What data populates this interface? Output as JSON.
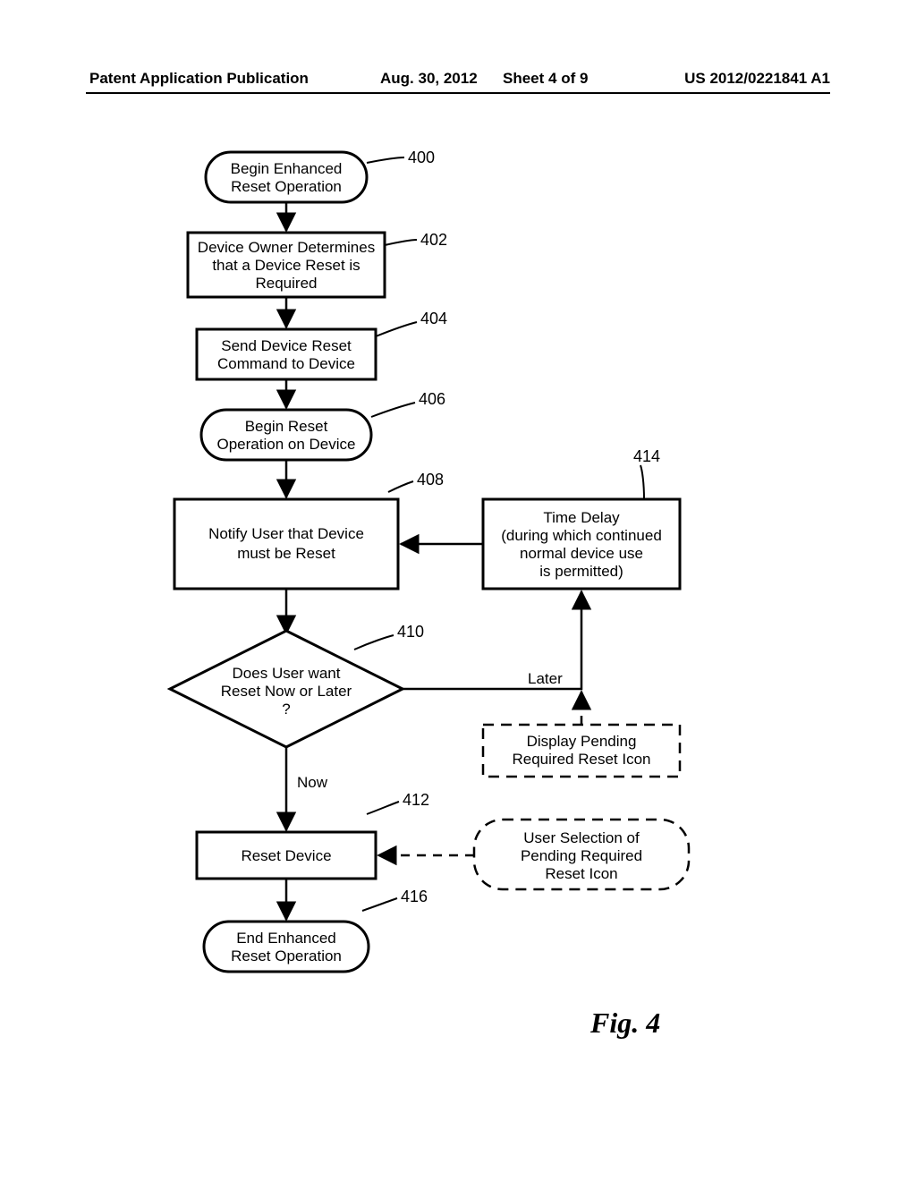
{
  "header": {
    "left": "Patent Application Publication",
    "date": "Aug. 30, 2012",
    "sheet": "Sheet 4 of 9",
    "pubno": "US 2012/0221841 A1"
  },
  "nodes": {
    "n400": {
      "ref": "400",
      "line1": "Begin Enhanced",
      "line2": "Reset Operation"
    },
    "n402": {
      "ref": "402",
      "line1": "Device Owner Determines",
      "line2": "that a Device Reset is",
      "line3": "Required"
    },
    "n404": {
      "ref": "404",
      "line1": "Send Device Reset",
      "line2": "Command to Device"
    },
    "n406": {
      "ref": "406",
      "line1": "Begin Reset",
      "line2": "Operation on Device"
    },
    "n408": {
      "ref": "408",
      "line1": "Notify User that Device",
      "line2": "must be Reset"
    },
    "n414": {
      "ref": "414",
      "line1": "Time Delay",
      "line2": "(during which continued",
      "line3": "normal device use",
      "line4": "is permitted)"
    },
    "n410": {
      "ref": "410",
      "line1": "Does User want",
      "line2": "Reset Now or Later",
      "line3": "?"
    },
    "n412": {
      "ref": "412",
      "line1": "Reset Device"
    },
    "n416": {
      "ref": "416",
      "line1": "End Enhanced",
      "line2": "Reset Operation"
    },
    "pending_display": {
      "line1": "Display Pending",
      "line2": "Required Reset Icon"
    },
    "pending_select": {
      "line1": "User Selection of",
      "line2": "Pending Required",
      "line3": "Reset Icon"
    }
  },
  "branches": {
    "now": "Now",
    "later": "Later"
  },
  "figure_label": "Fig. 4"
}
